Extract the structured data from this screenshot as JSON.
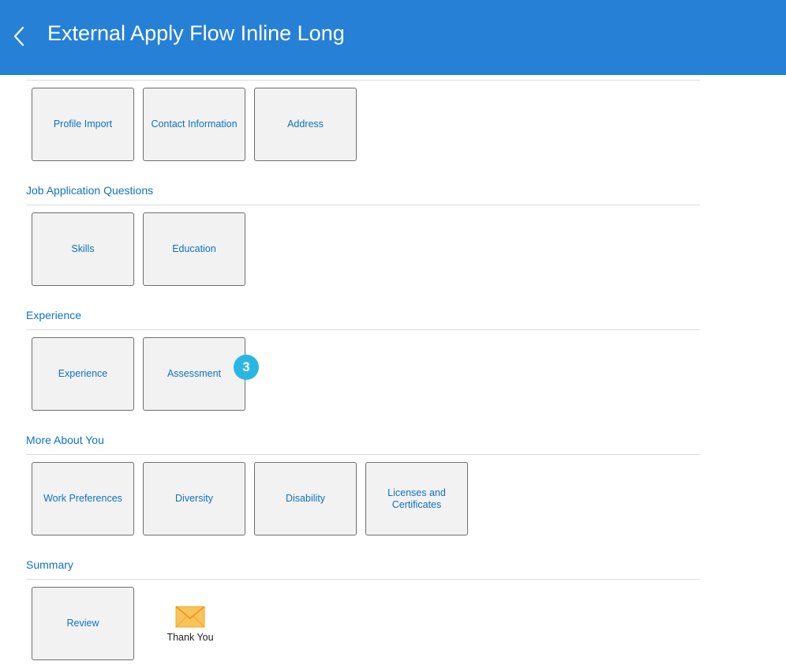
{
  "header": {
    "title": "External Apply Flow Inline Long"
  },
  "sections": [
    {
      "title": "",
      "tiles": [
        "Profile Import",
        "Contact Information",
        "Address"
      ]
    },
    {
      "title": "Job Application Questions",
      "tiles": [
        "Skills",
        "Education"
      ]
    },
    {
      "title": "Experience",
      "tiles": [
        "Experience",
        "Assessment"
      ]
    },
    {
      "title": "More About You",
      "tiles": [
        "Work Preferences",
        "Diversity",
        "Disability",
        "Licenses and Certificates"
      ]
    },
    {
      "title": "Summary",
      "tiles": [
        "Review"
      ]
    }
  ],
  "badge": {
    "value": "3"
  },
  "thank_you": {
    "label": "Thank You",
    "icon": "envelope-icon"
  },
  "colors": {
    "header_bg": "#2680d6",
    "link": "#0f73c3",
    "badge": "#29b6e3",
    "envelope": "#f5b63b"
  }
}
